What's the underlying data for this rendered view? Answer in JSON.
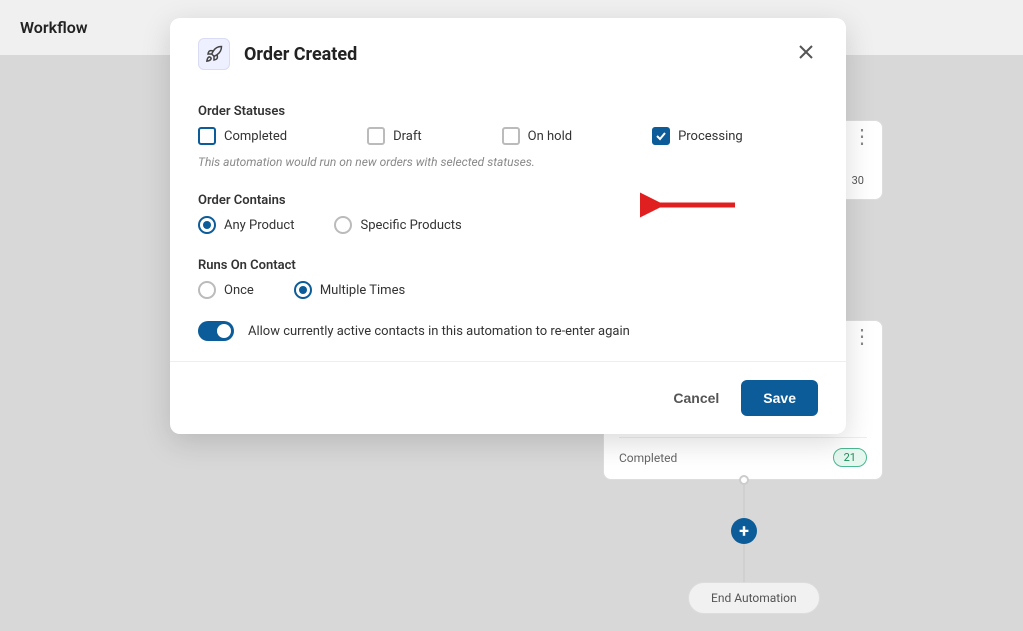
{
  "page": {
    "title": "Workflow"
  },
  "bg": {
    "top_badge": "30",
    "mid_label": "Completed",
    "mid_badge": "21",
    "end_label": "End Automation"
  },
  "modal": {
    "title": "Order Created",
    "statuses": {
      "label": "Order Statuses",
      "hint": "This automation would run on new orders with selected statuses.",
      "items": [
        {
          "label": "Completed",
          "checked": false,
          "highlight": true
        },
        {
          "label": "Draft",
          "checked": false,
          "highlight": false
        },
        {
          "label": "On hold",
          "checked": false,
          "highlight": false
        },
        {
          "label": "Processing",
          "checked": true,
          "highlight": false
        }
      ]
    },
    "contains": {
      "label": "Order Contains",
      "items": [
        {
          "label": "Any Product",
          "selected": true
        },
        {
          "label": "Specific Products",
          "selected": false
        }
      ]
    },
    "runs": {
      "label": "Runs On Contact",
      "items": [
        {
          "label": "Once",
          "selected": false
        },
        {
          "label": "Multiple Times",
          "selected": true
        }
      ]
    },
    "reenter_label": "Allow currently active contacts in this automation to re-enter again",
    "footer": {
      "cancel": "Cancel",
      "save": "Save"
    }
  }
}
